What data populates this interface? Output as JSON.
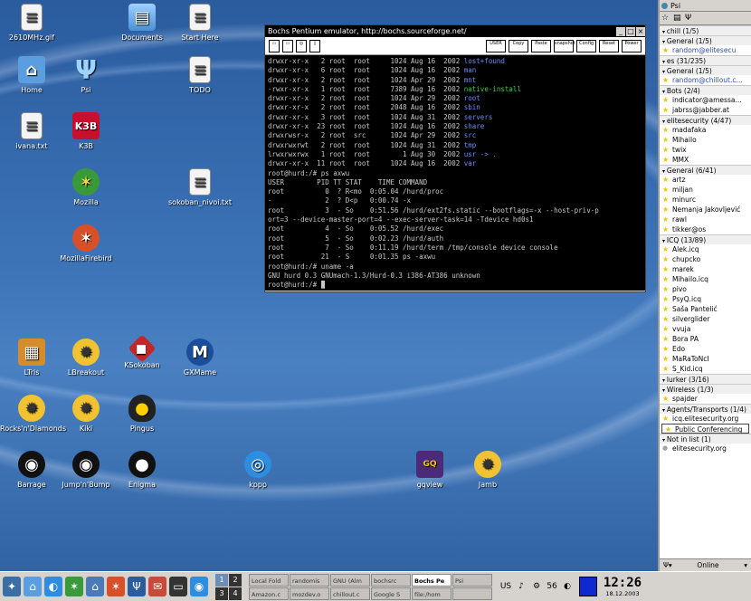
{
  "desktop_icons": [
    {
      "name": "desktop-icon-2610mhz",
      "label": "2610MHz.gif",
      "glyph": "≡",
      "cls": "g-doc"
    },
    {
      "name": "desktop-icon-home",
      "label": "Home",
      "glyph": "⌂",
      "cls": "g-home"
    },
    {
      "name": "desktop-icon-ivana",
      "label": "ivana.txt",
      "glyph": "≡",
      "cls": "g-doc"
    },
    {
      "name": "desktop-icon-documents",
      "label": "Documents",
      "glyph": "▤",
      "cls": "g-folder"
    },
    {
      "name": "desktop-icon-psi",
      "label": "Psi",
      "glyph": "Ψ",
      "cls": "g-psi"
    },
    {
      "name": "desktop-icon-k3b",
      "label": "K3B",
      "glyph": "K3B",
      "cls": "g-k3b"
    },
    {
      "name": "desktop-icon-mozilla",
      "label": "Mozilla",
      "glyph": "✶",
      "cls": "g-moz"
    },
    {
      "name": "desktop-icon-mozillafirebird",
      "label": "MozillaFirebird",
      "glyph": "✶",
      "cls": "g-fox"
    },
    {
      "name": "desktop-icon-start-here",
      "label": "Start Here",
      "glyph": "≡",
      "cls": "g-doc"
    },
    {
      "name": "desktop-icon-todo",
      "label": "TODO",
      "glyph": "≡",
      "cls": "g-doc"
    },
    {
      "name": "desktop-icon-sokoban-nivoi",
      "label": "sokoban_nivoi.txt",
      "glyph": "≡",
      "cls": "g-doc"
    },
    {
      "name": "desktop-icon-ltris",
      "label": "LTris",
      "glyph": "▦",
      "cls": "g-ltris"
    },
    {
      "name": "desktop-icon-lbreakout",
      "label": "LBreakout",
      "glyph": "✹",
      "cls": "g-gear"
    },
    {
      "name": "desktop-icon-ksokoban",
      "label": "KSokoban",
      "glyph": "◆",
      "cls": "g-ruby"
    },
    {
      "name": "desktop-icon-gxmame",
      "label": "GXMame",
      "glyph": "M",
      "cls": "g-gx"
    },
    {
      "name": "desktop-icon-rocks-n-diamonds",
      "label": "Rocks'n'Diamonds",
      "glyph": "✹",
      "cls": "g-gear"
    },
    {
      "name": "desktop-icon-kiki",
      "label": "Kiki",
      "glyph": "✹",
      "cls": "g-gear"
    },
    {
      "name": "desktop-icon-pingus",
      "label": "Pingus",
      "glyph": "●",
      "cls": "g-peng"
    },
    {
      "name": "desktop-icon-barrage",
      "label": "Barrage",
      "glyph": "◉",
      "cls": "g-ball"
    },
    {
      "name": "desktop-icon-jump-n-bump",
      "label": "Jump'n'Bump",
      "glyph": "◉",
      "cls": "g-ball"
    },
    {
      "name": "desktop-icon-enigma",
      "label": "Enigma",
      "glyph": "●",
      "cls": "g-ball"
    },
    {
      "name": "desktop-icon-kppp",
      "label": "kppp",
      "glyph": "◎",
      "cls": "g-kppp"
    },
    {
      "name": "desktop-icon-gqview",
      "label": "gqview",
      "glyph": "GQ",
      "cls": "g-gq"
    },
    {
      "name": "desktop-icon-jamb",
      "label": "Jamb",
      "glyph": "✹",
      "cls": "g-gear"
    }
  ],
  "terminal": {
    "title": "Bochs Pentium emulator, http://bochs.sourceforge.net/",
    "toolbar": [
      "USER",
      "Copy",
      "Paste",
      "snapshot",
      "Config",
      "Reset",
      "Power"
    ],
    "lines": [
      [
        "drwxr-xr-x",
        "2 root",
        "root",
        "1024 Aug 16",
        "2002",
        "lost+found",
        "dir"
      ],
      [
        "drwxr-xr-x",
        "6 root",
        "root",
        "1024 Aug 16",
        "2002",
        "man",
        "dir"
      ],
      [
        "drwxr-xr-x",
        "2 root",
        "root",
        "1024 Apr 29",
        "2002",
        "mnt",
        "dir"
      ],
      [
        "-rwxr-xr-x",
        "1 root",
        "root",
        "7389 Aug 16",
        "2002",
        "native-install",
        "exe"
      ],
      [
        "drwxr-xr-x",
        "2 root",
        "root",
        "1024 Apr 29",
        "2002",
        "root",
        "dir"
      ],
      [
        "drwxr-xr-x",
        "2 root",
        "root",
        "2048 Aug 16",
        "2002",
        "sbin",
        "dir"
      ],
      [
        "drwxr-xr-x",
        "3 root",
        "root",
        "1024 Aug 31",
        "2002",
        "servers",
        "dir"
      ],
      [
        "drwxr-xr-x",
        "23 root",
        "root",
        "1024 Aug 16",
        "2002",
        "share",
        "dir"
      ],
      [
        "drwxrwsr-x",
        "2 root",
        "src",
        "1024 Apr 29",
        "2002",
        "src",
        "dir"
      ],
      [
        "drwxrwxrwt",
        "2 root",
        "root",
        "1024 Aug 31",
        "2002",
        "tmp",
        "dir"
      ],
      [
        "lrwxrwxrwx",
        "1 root",
        "root",
        "1 Aug 30",
        "2002",
        "usr -> .",
        "dir"
      ],
      [
        "drwxr-xr-x",
        "11 root",
        "root",
        "1024 Aug 16",
        "2002",
        "var",
        "dir"
      ]
    ],
    "prompt1": "root@hurd:/# ps axwu",
    "ps_header": "USER        PID TT STAT    TIME COMMAND",
    "ps_rows": [
      "root          0  ? R<mo  0:05.04 /hurd/proc",
      "-             2  ? D<p   0:00.74 -x",
      "root          3  - So    0:51.56 /hurd/ext2fs.static --bootflags=-x --host-priv-p",
      "ort=3 --device-master-port=4 --exec-server-task=14 -Tdevice hd0s1",
      "root          4  - So    0:05.52 /hurd/exec",
      "root          5  - So    0:02.23 /hurd/auth",
      "root          7  - So    0:11.19 /hurd/term /tmp/console device console",
      "root         21  - S     0:01.35 ps -axwu"
    ],
    "prompt2": "root@hurd:/# uname -a",
    "uname": "GNU hurd 0.3 GNUmach-1.3/Hurd-0.3 i386-AT386 unknown",
    "prompt3": "root@hurd:/# "
  },
  "psi": {
    "title": "Psi",
    "status": "Online",
    "roster": [
      {
        "type": "account",
        "label": "chill  (1/5)"
      },
      {
        "type": "group",
        "label": "General (1/5)"
      },
      {
        "type": "contact",
        "label": "random@elitesecu",
        "state": "away"
      },
      {
        "type": "account",
        "label": "es  (31/235)"
      },
      {
        "type": "group",
        "label": "General (1/5)"
      },
      {
        "type": "contact",
        "label": "random@chillout.c...",
        "state": "away"
      },
      {
        "type": "group",
        "label": "Bots (2/4)"
      },
      {
        "type": "contact",
        "label": "indicator@amessa...",
        "state": "online"
      },
      {
        "type": "contact",
        "label": "jabrss@jabber.at",
        "state": "online"
      },
      {
        "type": "group",
        "label": "elitesecurity (4/47)"
      },
      {
        "type": "contact",
        "label": "madafaka",
        "state": "online"
      },
      {
        "type": "contact",
        "label": "Mihailo",
        "state": "online"
      },
      {
        "type": "contact",
        "label": "twix",
        "state": "online"
      },
      {
        "type": "contact",
        "label": "MMX",
        "state": "online"
      },
      {
        "type": "group",
        "label": "General (6/41)"
      },
      {
        "type": "contact",
        "label": "artz",
        "state": "online"
      },
      {
        "type": "contact",
        "label": "miljan",
        "state": "online"
      },
      {
        "type": "contact",
        "label": "minurc",
        "state": "online"
      },
      {
        "type": "contact",
        "label": "Nemanja Jakovljević",
        "state": "online"
      },
      {
        "type": "contact",
        "label": "rawl",
        "state": "online"
      },
      {
        "type": "contact",
        "label": "tikker@os",
        "state": "online"
      },
      {
        "type": "group",
        "label": "ICQ (13/89)"
      },
      {
        "type": "contact",
        "label": "Alek.icq",
        "state": "online"
      },
      {
        "type": "contact",
        "label": "chupcko",
        "state": "online"
      },
      {
        "type": "contact",
        "label": "marek",
        "state": "online"
      },
      {
        "type": "contact",
        "label": "Mihailo.icq",
        "state": "online"
      },
      {
        "type": "contact",
        "label": "pivo",
        "state": "online"
      },
      {
        "type": "contact",
        "label": "PsyQ.icq",
        "state": "online"
      },
      {
        "type": "contact",
        "label": "Saša Pantelić",
        "state": "online"
      },
      {
        "type": "contact",
        "label": "silverglider",
        "state": "online"
      },
      {
        "type": "contact",
        "label": "vvuja",
        "state": "online"
      },
      {
        "type": "contact",
        "label": "Bora PA",
        "state": "online"
      },
      {
        "type": "contact",
        "label": "Edo",
        "state": "online"
      },
      {
        "type": "contact",
        "label": "MaRaToNcI",
        "state": "online"
      },
      {
        "type": "contact",
        "label": "S_Kid.icq",
        "state": "online"
      },
      {
        "type": "group",
        "label": "lurker (3/16)"
      },
      {
        "type": "group",
        "label": "Wireless (1/3)"
      },
      {
        "type": "contact",
        "label": "spajder",
        "state": "online"
      },
      {
        "type": "group",
        "label": "Agents/Transports (1/4)"
      },
      {
        "type": "contact",
        "label": "icq.elitesecurity.org",
        "state": "online"
      },
      {
        "type": "contact",
        "label": "Public Conferencing",
        "state": "boxed"
      },
      {
        "type": "group",
        "label": "Not in list (1)"
      },
      {
        "type": "contact",
        "label": "elitesecurity.org",
        "state": "off"
      }
    ]
  },
  "taskbar": {
    "launchers": [
      {
        "name": "launcher-kmenu-icon",
        "glyph": "✦",
        "color": "#3a6ea5"
      },
      {
        "name": "launcher-home-icon",
        "glyph": "⌂",
        "color": "#5b9ee0"
      },
      {
        "name": "launcher-konqueror-icon",
        "glyph": "◐",
        "color": "#2d8de0"
      },
      {
        "name": "launcher-mozilla-icon",
        "glyph": "✶",
        "color": "#3a9a3a"
      },
      {
        "name": "launcher-home2-icon",
        "glyph": "⌂",
        "color": "#4a7ab8"
      },
      {
        "name": "launcher-firebird-icon",
        "glyph": "✶",
        "color": "#d8502a"
      },
      {
        "name": "launcher-psi-icon",
        "glyph": "Ψ",
        "color": "#2a5c9e"
      },
      {
        "name": "launcher-mail-icon",
        "glyph": "✉",
        "color": "#c84a3a"
      },
      {
        "name": "launcher-konsole-icon",
        "glyph": "▭",
        "color": "#333333"
      },
      {
        "name": "launcher-browser-icon",
        "glyph": "◉",
        "color": "#2d8de0"
      }
    ],
    "pager": [
      "1",
      "2",
      "3",
      "4"
    ],
    "tasks": [
      "Local Fold",
      "randomis",
      "GNU (Alm",
      "bochsrc",
      "Bochs Pe",
      "Psi",
      "Amazon.c",
      "mozdev.o",
      "chillout.c",
      "Google S",
      "file:/hom",
      ""
    ],
    "clock_time": "12:26",
    "clock_date": "18.12.2003",
    "tray": [
      "US",
      "♪",
      "⚙",
      "56",
      "◐"
    ]
  }
}
